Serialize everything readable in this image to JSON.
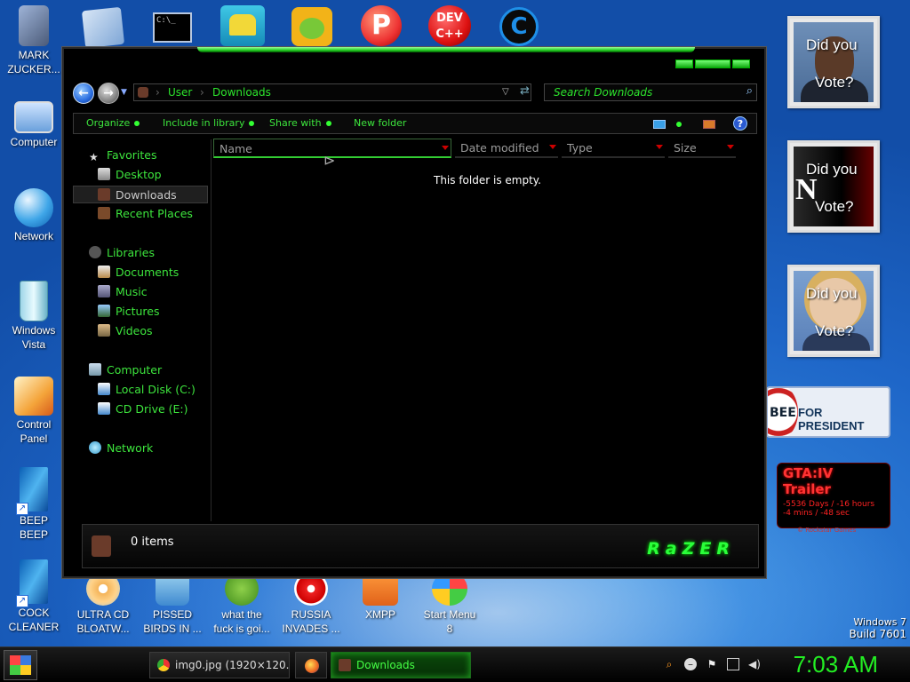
{
  "desktop": {
    "left_icons": [
      {
        "label": "MARK\nZUCKER...",
        "icon": "user-folder-icon"
      },
      {
        "label": "Computer",
        "icon": "computer-icon"
      },
      {
        "label": "Network",
        "icon": "network-globe-icon"
      },
      {
        "label": "Windows\nVista",
        "icon": "recycle-bin-icon"
      },
      {
        "label": "Control\nPanel",
        "icon": "control-panel-icon"
      },
      {
        "label": "BEEP\nBEEP",
        "icon": "blue-file-icon"
      },
      {
        "label": "COCK\nCLEANER",
        "icon": "blue-file-icon"
      }
    ],
    "bottom_icons": [
      {
        "label": "ULTRA CD\nBLOATW...",
        "icon": "cd-icon"
      },
      {
        "label": "PISSED\nBIRDS IN ...",
        "icon": "angry-birds-icon"
      },
      {
        "label": "what the\nfuck is goi...",
        "icon": "bad-piggies-icon"
      },
      {
        "label": "RUSSIA\nINVADES ...",
        "icon": "radiation-icon"
      },
      {
        "label": "XMPP",
        "icon": "xampp-icon"
      },
      {
        "label": "Start Menu\n8",
        "icon": "windows-orb-icon"
      }
    ],
    "top_icons": [
      "documents-icon",
      "cmd-icon",
      "paint-icon",
      "bad-piggies-icon",
      "p-app-icon",
      "dev-cpp-icon",
      "ccleaner-icon"
    ],
    "watermark": {
      "line1": "Windows 7",
      "line2": "Build 7601"
    }
  },
  "gadgets": [
    {
      "line1": "Did you",
      "line2": "Vote?",
      "photo": "obama"
    },
    {
      "line1": "Did you",
      "line2": "Vote?",
      "photo": "n-logo"
    },
    {
      "line1": "Did you",
      "line2": "Vote?",
      "photo": "clinton"
    }
  ],
  "huckabee": {
    "left": "BEE",
    "right": "FOR PRESIDENT"
  },
  "gta": {
    "title": "GTA:IV  Trailer",
    "line1": "-5536 Days / -16 hours",
    "line2": "-4 mins / -48 sec",
    "footer": "© Rockstar Games"
  },
  "explorer": {
    "breadcrumb": [
      "User",
      "Downloads"
    ],
    "search_placeholder": "Search Downloads",
    "toolbar": {
      "organize": "Organize",
      "include": "Include in library",
      "share": "Share with",
      "new_folder": "New folder"
    },
    "sidebar": {
      "favorites": "Favorites",
      "desktop": "Desktop",
      "downloads": "Downloads",
      "recent": "Recent Places",
      "libraries": "Libraries",
      "documents": "Documents",
      "music": "Music",
      "pictures": "Pictures",
      "videos": "Videos",
      "computer": "Computer",
      "local_disk": "Local Disk (C:)",
      "cd_drive": "CD Drive (E:)",
      "network": "Network"
    },
    "columns": [
      "Name",
      "Date modified",
      "Type",
      "Size"
    ],
    "empty_message": "This folder is empty.",
    "status_count": "0 items",
    "brand": "RaZER"
  },
  "taskbar": {
    "tasks": [
      {
        "label": "img0.jpg (1920×120...",
        "icon": "chrome-icon"
      },
      {
        "label": "",
        "icon": "firefox-icon"
      },
      {
        "label": "Downloads",
        "icon": "explorer-icon"
      }
    ],
    "clock": "7:03 AM"
  },
  "colors": {
    "accent_green": "#3de53d",
    "window_bg": "#000000",
    "desktop_blue": "#1e66c8"
  }
}
